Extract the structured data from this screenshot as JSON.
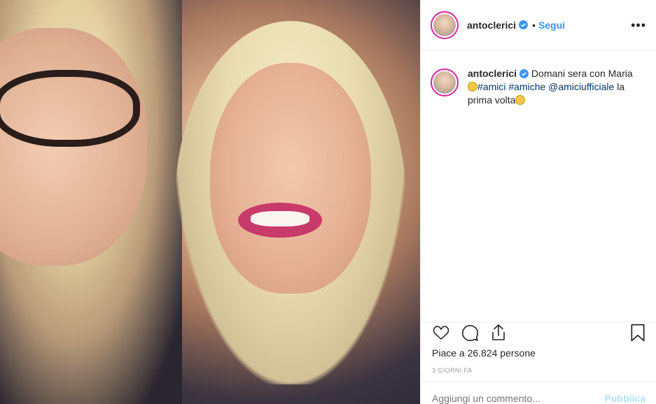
{
  "post": {
    "username": "antoclerici",
    "follow_label": "Segui",
    "more_label": "•••",
    "separator": "•"
  },
  "caption": {
    "username": "antoclerici",
    "text_1": "Domani sera con Maria",
    "hashtag_1": "#amici",
    "hashtag_2": "#amiche",
    "mention": "@amiciufficiale",
    "text_2": "la prima volta"
  },
  "stats": {
    "likes_label": "Piace a 26.824 persone",
    "timestamp": "3 giorni fa"
  },
  "comment_box": {
    "placeholder": "Aggiungi un commento...",
    "publish_label": "Pubblica"
  },
  "colors": {
    "accent": "#3897f0",
    "ring": "#d6249f",
    "publish_disabled": "#b2dffc"
  },
  "icons": [
    "verified-badge-icon",
    "heart-icon",
    "comment-icon",
    "share-icon",
    "bookmark-icon",
    "more-options-icon",
    "grimace-emoji-icon"
  ]
}
